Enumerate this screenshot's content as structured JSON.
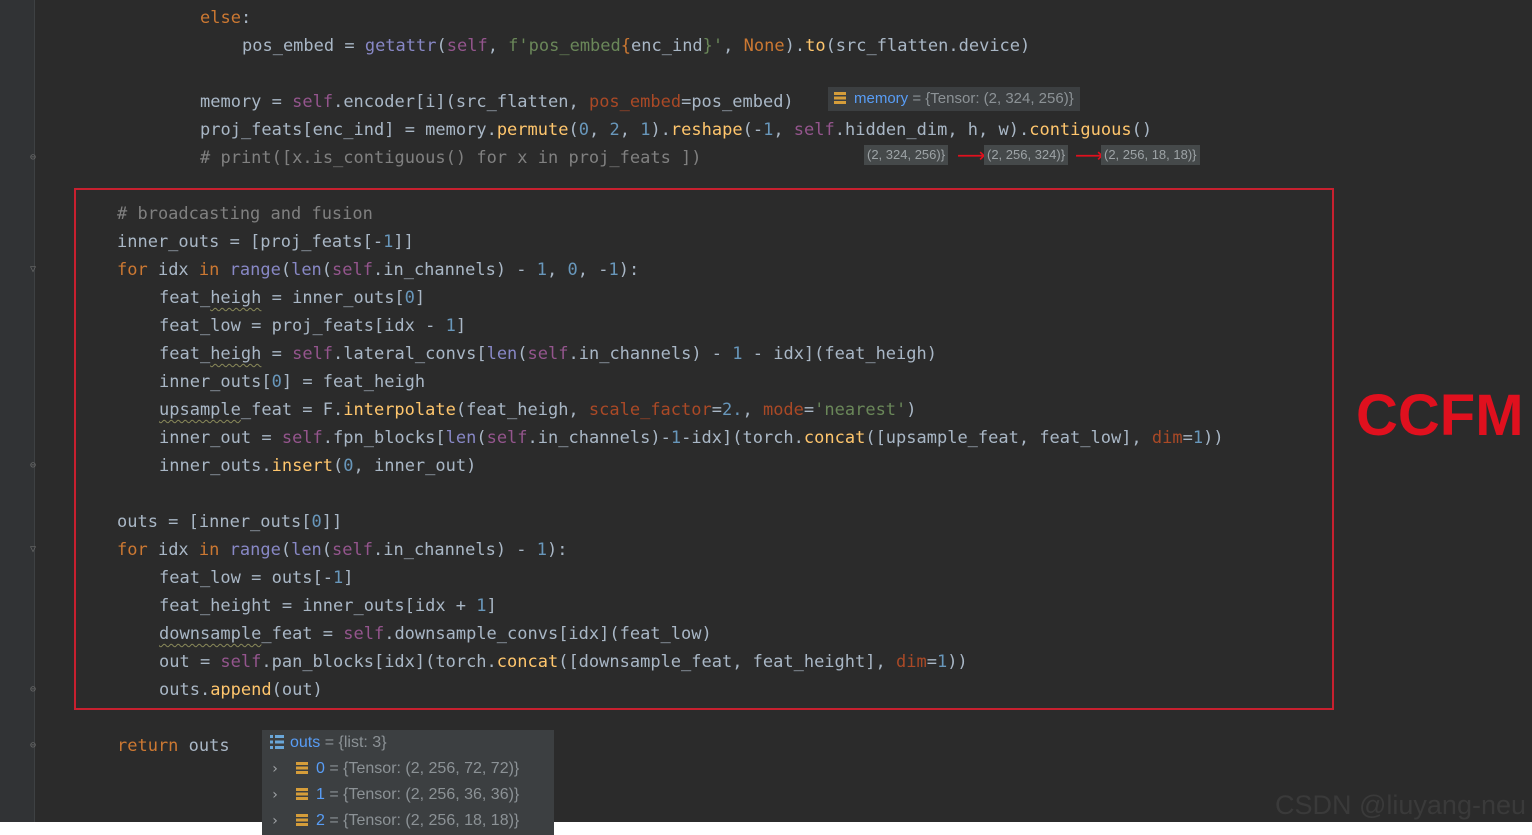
{
  "code_lines": [
    {
      "id": "l01",
      "tokens": [
        {
          "t": "else",
          "c": "kw"
        },
        {
          "t": ":"
        }
      ]
    },
    {
      "id": "l02",
      "tokens": [
        {
          "t": "pos_embed = "
        },
        {
          "t": "getattr",
          "c": "bi"
        },
        {
          "t": "("
        },
        {
          "t": "self",
          "c": "self"
        },
        {
          "t": ", "
        },
        {
          "t": "f'pos_embed",
          "c": "str"
        },
        {
          "t": "{",
          "c": "kw"
        },
        {
          "t": "enc_ind"
        },
        {
          "t": "}'",
          "c": "str"
        },
        {
          "t": ", "
        },
        {
          "t": "None",
          "c": "none"
        },
        {
          "t": ")."
        },
        {
          "t": "to",
          "c": "fn"
        },
        {
          "t": "(src_flatten.device)"
        }
      ]
    },
    {
      "id": "l04",
      "tokens": [
        {
          "t": "memory = "
        },
        {
          "t": "self",
          "c": "self"
        },
        {
          "t": ".encoder[i](src_flatten, "
        },
        {
          "t": "pos_embed",
          "c": "kwarg"
        },
        {
          "t": "=pos_embed)"
        }
      ]
    },
    {
      "id": "l05",
      "tokens": [
        {
          "t": "proj_feats[enc_ind] = memory."
        },
        {
          "t": "permute",
          "c": "fn"
        },
        {
          "t": "("
        },
        {
          "t": "0",
          "c": "num"
        },
        {
          "t": ", "
        },
        {
          "t": "2",
          "c": "num"
        },
        {
          "t": ", "
        },
        {
          "t": "1",
          "c": "num"
        },
        {
          "t": ")."
        },
        {
          "t": "reshape",
          "c": "fn"
        },
        {
          "t": "(-"
        },
        {
          "t": "1",
          "c": "num"
        },
        {
          "t": ", "
        },
        {
          "t": "self",
          "c": "self"
        },
        {
          "t": ".hidden_dim, h, w)."
        },
        {
          "t": "contiguous",
          "c": "fn"
        },
        {
          "t": "()"
        }
      ]
    },
    {
      "id": "l06",
      "tokens": [
        {
          "t": "# print([x.is_contiguous() for x in proj_feats ])",
          "c": "cmt"
        }
      ]
    },
    {
      "id": "l08",
      "tokens": [
        {
          "t": "# broadcasting and fusion",
          "c": "cmt"
        }
      ]
    },
    {
      "id": "l09",
      "tokens": [
        {
          "t": "inner_outs = [proj_feats[-"
        },
        {
          "t": "1",
          "c": "num"
        },
        {
          "t": "]]"
        }
      ]
    },
    {
      "id": "l10",
      "tokens": [
        {
          "t": "for",
          "c": "kw"
        },
        {
          "t": " idx "
        },
        {
          "t": "in",
          "c": "kw"
        },
        {
          "t": " "
        },
        {
          "t": "range",
          "c": "bi"
        },
        {
          "t": "("
        },
        {
          "t": "len",
          "c": "bi"
        },
        {
          "t": "("
        },
        {
          "t": "self",
          "c": "self"
        },
        {
          "t": ".in_channels) - "
        },
        {
          "t": "1",
          "c": "num"
        },
        {
          "t": ", "
        },
        {
          "t": "0",
          "c": "num"
        },
        {
          "t": ", -"
        },
        {
          "t": "1",
          "c": "num"
        },
        {
          "t": "):"
        }
      ]
    },
    {
      "id": "l11",
      "tokens": [
        {
          "t": "feat_"
        },
        {
          "t": "heigh",
          "c": "wavy"
        },
        {
          "t": " = inner_outs["
        },
        {
          "t": "0",
          "c": "num"
        },
        {
          "t": "]"
        }
      ]
    },
    {
      "id": "l12",
      "tokens": [
        {
          "t": "feat_low = proj_feats[idx - "
        },
        {
          "t": "1",
          "c": "num"
        },
        {
          "t": "]"
        }
      ]
    },
    {
      "id": "l13",
      "tokens": [
        {
          "t": "feat_"
        },
        {
          "t": "heigh",
          "c": "wavy"
        },
        {
          "t": " = "
        },
        {
          "t": "self",
          "c": "self"
        },
        {
          "t": ".lateral_convs["
        },
        {
          "t": "len",
          "c": "bi"
        },
        {
          "t": "("
        },
        {
          "t": "self",
          "c": "self"
        },
        {
          "t": ".in_channels) - "
        },
        {
          "t": "1",
          "c": "num"
        },
        {
          "t": " - idx](feat_heigh)"
        }
      ]
    },
    {
      "id": "l14",
      "tokens": [
        {
          "t": "inner_outs["
        },
        {
          "t": "0",
          "c": "num"
        },
        {
          "t": "] = feat_heigh"
        }
      ]
    },
    {
      "id": "l15",
      "tokens": [
        {
          "t": "upsample",
          "c": "wavy"
        },
        {
          "t": "_feat = F."
        },
        {
          "t": "interpolate",
          "c": "fn"
        },
        {
          "t": "(feat_heigh, "
        },
        {
          "t": "scale_factor",
          "c": "kwarg"
        },
        {
          "t": "="
        },
        {
          "t": "2.",
          "c": "num"
        },
        {
          "t": ", "
        },
        {
          "t": "mode",
          "c": "kwarg"
        },
        {
          "t": "="
        },
        {
          "t": "'nearest'",
          "c": "str"
        },
        {
          "t": ")"
        }
      ]
    },
    {
      "id": "l16",
      "tokens": [
        {
          "t": "inner_out = "
        },
        {
          "t": "self",
          "c": "self"
        },
        {
          "t": ".fpn_blocks["
        },
        {
          "t": "len",
          "c": "bi"
        },
        {
          "t": "("
        },
        {
          "t": "self",
          "c": "self"
        },
        {
          "t": ".in_channels)-"
        },
        {
          "t": "1",
          "c": "num"
        },
        {
          "t": "-idx](torch."
        },
        {
          "t": "concat",
          "c": "fn"
        },
        {
          "t": "([upsample_feat, feat_low], "
        },
        {
          "t": "dim",
          "c": "kwarg"
        },
        {
          "t": "="
        },
        {
          "t": "1",
          "c": "num"
        },
        {
          "t": "))"
        }
      ]
    },
    {
      "id": "l17",
      "tokens": [
        {
          "t": "inner_outs."
        },
        {
          "t": "insert",
          "c": "fn"
        },
        {
          "t": "("
        },
        {
          "t": "0",
          "c": "num"
        },
        {
          "t": ", inner_out)"
        }
      ]
    },
    {
      "id": "l19",
      "tokens": [
        {
          "t": "outs = [inner_outs["
        },
        {
          "t": "0",
          "c": "num"
        },
        {
          "t": "]]"
        }
      ]
    },
    {
      "id": "l20",
      "tokens": [
        {
          "t": "for",
          "c": "kw"
        },
        {
          "t": " idx "
        },
        {
          "t": "in",
          "c": "kw"
        },
        {
          "t": " "
        },
        {
          "t": "range",
          "c": "bi"
        },
        {
          "t": "("
        },
        {
          "t": "len",
          "c": "bi"
        },
        {
          "t": "("
        },
        {
          "t": "self",
          "c": "self"
        },
        {
          "t": ".in_channels) - "
        },
        {
          "t": "1",
          "c": "num"
        },
        {
          "t": "):"
        }
      ]
    },
    {
      "id": "l21",
      "tokens": [
        {
          "t": "feat_low = outs[-"
        },
        {
          "t": "1",
          "c": "num"
        },
        {
          "t": "]"
        }
      ]
    },
    {
      "id": "l22",
      "tokens": [
        {
          "t": "feat_height = inner_outs[idx + "
        },
        {
          "t": "1",
          "c": "num"
        },
        {
          "t": "]"
        }
      ]
    },
    {
      "id": "l23",
      "tokens": [
        {
          "t": "downsample",
          "c": "wavy"
        },
        {
          "t": "_feat = "
        },
        {
          "t": "self",
          "c": "self"
        },
        {
          "t": ".downsample_convs[idx](feat_low)"
        }
      ]
    },
    {
      "id": "l24",
      "tokens": [
        {
          "t": "out = "
        },
        {
          "t": "self",
          "c": "self"
        },
        {
          "t": ".pan_blocks[idx](torch."
        },
        {
          "t": "concat",
          "c": "fn"
        },
        {
          "t": "([downsample_feat, feat_height], "
        },
        {
          "t": "dim",
          "c": "kwarg"
        },
        {
          "t": "="
        },
        {
          "t": "1",
          "c": "num"
        },
        {
          "t": "))"
        }
      ]
    },
    {
      "id": "l25",
      "tokens": [
        {
          "t": "outs."
        },
        {
          "t": "append",
          "c": "fn"
        },
        {
          "t": "(out)"
        }
      ]
    },
    {
      "id": "l27",
      "tokens": [
        {
          "t": "return",
          "c": "kw"
        },
        {
          "t": " outs"
        }
      ]
    }
  ],
  "memory_hint": {
    "name": "memory",
    "eq": "=",
    "value": "{Tensor: (2, 324, 256)}"
  },
  "shape_chain": [
    "(2, 324, 256)}",
    "(2, 256, 324)}",
    "(2, 256, 18, 18)}"
  ],
  "ccfm_label": "CCFM",
  "outs_popup": {
    "header": {
      "name": "outs",
      "eq": "=",
      "value": "{list: 3}"
    },
    "items": [
      {
        "name": "0",
        "eq": "=",
        "value": "{Tensor: (2, 256, 72, 72)}"
      },
      {
        "name": "1",
        "eq": "=",
        "value": "{Tensor: (2, 256, 36, 36)}"
      },
      {
        "name": "2",
        "eq": "=",
        "value": "{Tensor: (2, 256, 18, 18)}"
      }
    ]
  },
  "watermark": "CSDN @liuyang-neu",
  "colors": {
    "background": "#2b2b2b",
    "accent_red": "#e0101e",
    "box_border": "#c8202f"
  }
}
